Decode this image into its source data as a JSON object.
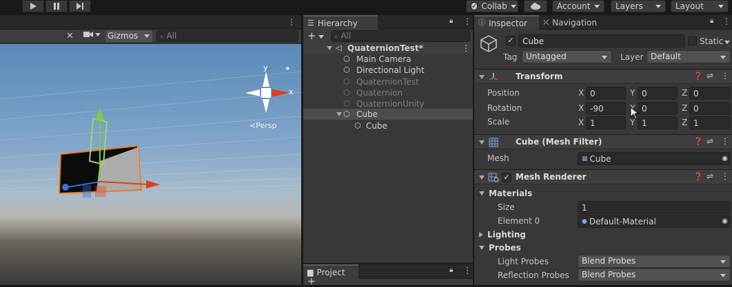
{
  "toolbar": {
    "collab_label": "Collab",
    "account_label": "Account",
    "layers_label": "Layers",
    "layout_label": "Layout"
  },
  "scene": {
    "gizmos_label": "Gizmos",
    "search_placeholder": "All",
    "persp_label": "Persp",
    "axis_y": "y",
    "axis_x": "x"
  },
  "hierarchy": {
    "tab_label": "Hierarchy",
    "search_placeholder": "All",
    "scene_name": "QuaternionTest*",
    "items": [
      {
        "label": "Main Camera",
        "dim": false
      },
      {
        "label": "Directional Light",
        "dim": false
      },
      {
        "label": "QuaternionTest",
        "dim": true
      },
      {
        "label": "Quaternion",
        "dim": true
      },
      {
        "label": "QuaternionUnity",
        "dim": true
      },
      {
        "label": "Cube",
        "dim": false
      },
      {
        "label": "Cube",
        "dim": false
      }
    ]
  },
  "project": {
    "tab_label": "Project"
  },
  "inspector": {
    "tab_label": "Inspector",
    "nav_tab_label": "Navigation",
    "object_name": "Cube",
    "static_label": "Static",
    "tag_label": "Tag",
    "tag_value": "Untagged",
    "layer_label": "Layer",
    "layer_value": "Default",
    "transform": {
      "title": "Transform",
      "position_label": "Position",
      "rotation_label": "Rotation",
      "scale_label": "Scale",
      "axis_x": "X",
      "axis_y": "Y",
      "axis_z": "Z",
      "position": {
        "x": "0",
        "y": "0",
        "z": "0"
      },
      "rotation": {
        "x": "-90",
        "y": "0",
        "z": "0"
      },
      "scale": {
        "x": "1",
        "y": "1",
        "z": "1"
      }
    },
    "mesh_filter": {
      "title": "Cube (Mesh Filter)",
      "mesh_label": "Mesh",
      "mesh_value": "Cube"
    },
    "mesh_renderer": {
      "title": "Mesh Renderer",
      "materials_label": "Materials",
      "size_label": "Size",
      "size_value": "1",
      "element0_label": "Element 0",
      "element0_value": "Default-Material",
      "lighting_label": "Lighting",
      "probes_label": "Probes",
      "light_probes_label": "Light Probes",
      "light_probes_value": "Blend Probes",
      "reflection_probes_label": "Reflection Probes",
      "reflection_probes_value": "Blend Probes"
    }
  },
  "colors": {
    "selection": "#4d4d4d",
    "x_axis": "#e03c1c",
    "y_axis": "#7ad03a",
    "z_axis": "#3a6fd8",
    "outline": "#f07a1a"
  }
}
